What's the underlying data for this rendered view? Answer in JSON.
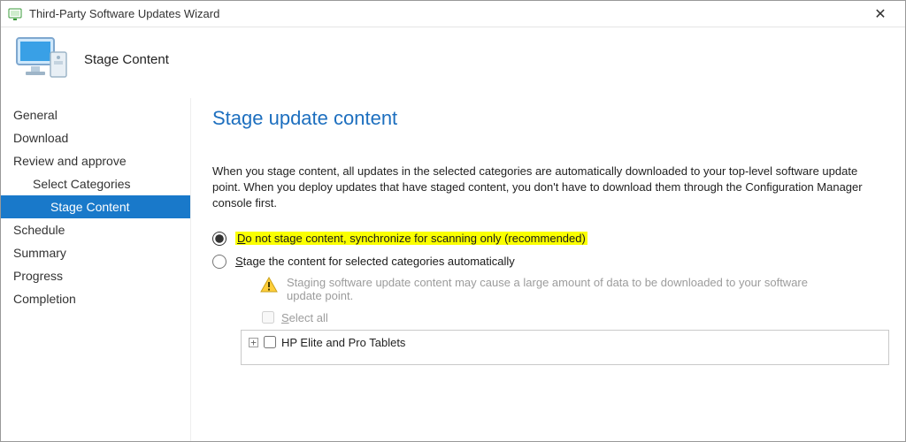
{
  "window": {
    "title": "Third-Party Software Updates Wizard"
  },
  "header": {
    "icon": "monitor-computer-icon",
    "title": "Stage Content"
  },
  "sidebar": {
    "items": [
      {
        "label": "General",
        "indent": 0,
        "selected": false
      },
      {
        "label": "Download",
        "indent": 0,
        "selected": false
      },
      {
        "label": "Review and approve",
        "indent": 0,
        "selected": false
      },
      {
        "label": "Select Categories",
        "indent": 1,
        "selected": false
      },
      {
        "label": "Stage Content",
        "indent": 2,
        "selected": true
      },
      {
        "label": "Schedule",
        "indent": 0,
        "selected": false
      },
      {
        "label": "Summary",
        "indent": 0,
        "selected": false
      },
      {
        "label": "Progress",
        "indent": 0,
        "selected": false
      },
      {
        "label": "Completion",
        "indent": 0,
        "selected": false
      }
    ]
  },
  "content": {
    "title": "Stage update content",
    "description": "When you stage content, all updates in the selected categories are automatically downloaded to your top-level software update point. When you deploy updates that have staged content, you don't have to download them through the Configuration Manager console first.",
    "radios": {
      "option_do_not_stage": {
        "access_key": "D",
        "rest": "o not stage content, synchronize for scanning only (recommended)",
        "checked": true,
        "highlighted": true
      },
      "option_stage": {
        "access_key": "S",
        "rest": "tage the content for selected categories automatically",
        "checked": false
      }
    },
    "warning": "Staging software update content may cause a large amount of data to be downloaded to your software update point.",
    "select_all": {
      "access_key": "S",
      "rest": "elect all",
      "checked": false,
      "disabled": true
    },
    "tree": {
      "items": [
        {
          "label": "HP Elite and Pro Tablets",
          "checked": false,
          "expandable": true
        }
      ]
    }
  }
}
